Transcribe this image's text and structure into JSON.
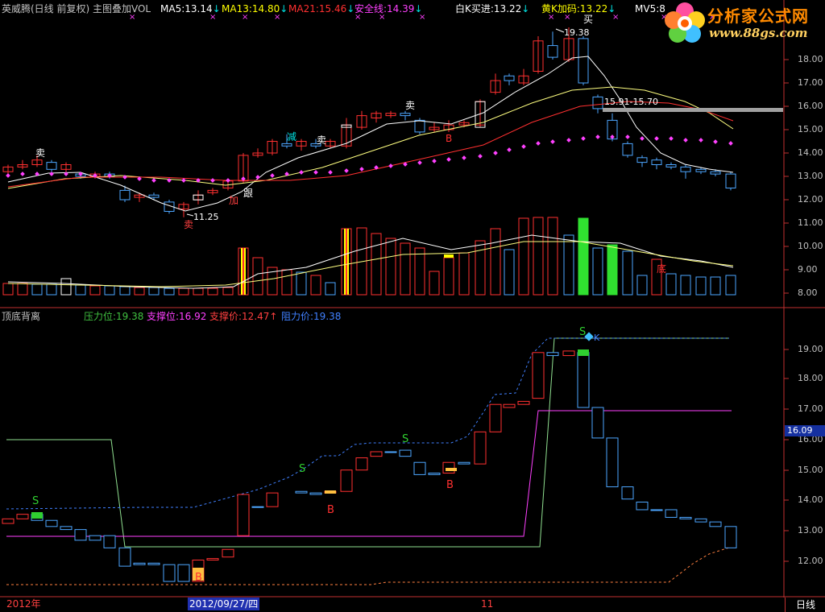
{
  "main_header": {
    "title": "英威腾(日线 前复权) 主图叠加VOL",
    "ma5": {
      "label": "MA5:",
      "value": "13.14",
      "arrow": "↓",
      "color": "#ffffff"
    },
    "ma13": {
      "label": "MA13:",
      "value": "14.80",
      "arrow": "↓",
      "color": "#ffff00"
    },
    "ma21": {
      "label": "MA21:",
      "value": "15.46",
      "arrow": "↓",
      "color": "#ff3030"
    },
    "safe": {
      "label": "安全线:",
      "value": "14.39",
      "arrow": "↓",
      "color": "#ff40ff"
    },
    "white_k": {
      "label": "白K买进:",
      "value": "13.22",
      "arrow": "↓",
      "color": "#ffffff"
    },
    "yellow_k": {
      "label": "黄K加码:",
      "value": "13.22",
      "arrow": "↓",
      "color": "#ffff00"
    },
    "mv5": {
      "label": "MV5:",
      "value": "8",
      "color": "#ffffff"
    }
  },
  "logo": {
    "name": "分析家公式网",
    "url_text": "www.88gs.com"
  },
  "main_price_axis": [
    "18.00",
    "17.00",
    "16.00",
    "15.00",
    "14.00",
    "13.00",
    "12.00",
    "11.00",
    "10.00",
    "9.00",
    "8.00"
  ],
  "main_annotations": {
    "sell_labels": [
      "卖",
      "卖",
      "卖",
      "卖"
    ],
    "buy_label": "买",
    "reduce_label": "减",
    "add_label": "加",
    "follow_label": "跟",
    "b_label": "B",
    "bottom_label": "底",
    "low_price": "11.25",
    "high_price": "19.38",
    "range_label": "15.91-15.70"
  },
  "sub_header": {
    "title": "顶底背离",
    "pressure": {
      "label": "压力位:",
      "value": "19.38",
      "color": "#40c040"
    },
    "support": {
      "label": "支撑位:",
      "value": "16.92",
      "color": "#ff40ff"
    },
    "support_price": {
      "label": "支撑价:",
      "value": "12.47",
      "arrow": "↑",
      "color": "#ff4040"
    },
    "resist_price": {
      "label": "阻力价:",
      "value": "19.38",
      "color": "#4080ff"
    }
  },
  "sub_price_axis": [
    "19.00",
    "18.00",
    "17.00",
    "16.00",
    "15.00",
    "14.00",
    "13.00",
    "12.00"
  ],
  "sub_current_price": "16.09",
  "sub_annotations": {
    "s_label": "S",
    "b_label": "B",
    "k_label": "K"
  },
  "date_bar": {
    "year": "2012年",
    "selected": "2012/09/27/四",
    "month": "11"
  },
  "period_button": "日线"
}
